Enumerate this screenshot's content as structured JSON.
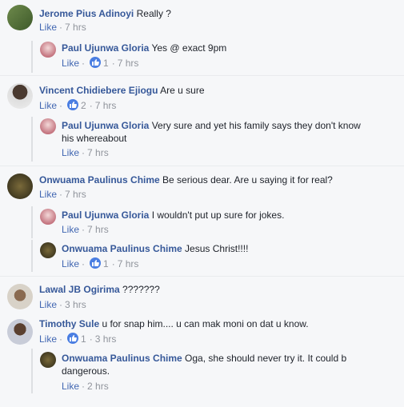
{
  "comments": [
    {
      "author": "Jerome Pius Adinoyi",
      "text": "Really ?",
      "like": "Like",
      "time": "7 hrs"
    },
    {
      "author": "Paul Ujunwa Gloria",
      "text": "Yes @ exact 9pm",
      "like": "Like",
      "reactions": "1",
      "time": "7 hrs"
    },
    {
      "author": "Vincent Chidiebere Ejiogu",
      "text": "Are u sure",
      "like": "Like",
      "reactions": "2",
      "time": "7 hrs"
    },
    {
      "author": "Paul Ujunwa Gloria",
      "text": "Very sure and yet his family says they don't know",
      "text2": "his whereabout",
      "like": "Like",
      "time": "7 hrs"
    },
    {
      "author": "Onwuama Paulinus Chime",
      "text": "Be serious dear. Are u saying it for real?",
      "like": "Like",
      "time": "7 hrs"
    },
    {
      "author": "Paul Ujunwa Gloria",
      "text": "I wouldn't put up sure for jokes.",
      "like": "Like",
      "time": "7 hrs"
    },
    {
      "author": "Onwuama Paulinus Chime",
      "text": "Jesus Christ!!!!",
      "like": "Like",
      "reactions": "1",
      "time": "7 hrs"
    },
    {
      "author": "Lawal JB Ogirima",
      "text": "???????",
      "like": "Like",
      "time": "3 hrs"
    },
    {
      "author": "Timothy Sule",
      "text": "u for snap him.... u can mak moni on dat u know.",
      "like": "Like",
      "reactions": "1",
      "time": "3 hrs"
    },
    {
      "author": "Onwuama Paulinus Chime",
      "text": "Oga, she should never try it. It could b",
      "text2": "dangerous.",
      "like": "Like",
      "time": "2 hrs"
    }
  ],
  "separator": "·",
  "icons": {
    "reaction": "like-thumb-icon"
  },
  "colors": {
    "link": "#365899",
    "accent": "#4267b2",
    "muted": "#90949c",
    "background": "#f6f7f9"
  }
}
